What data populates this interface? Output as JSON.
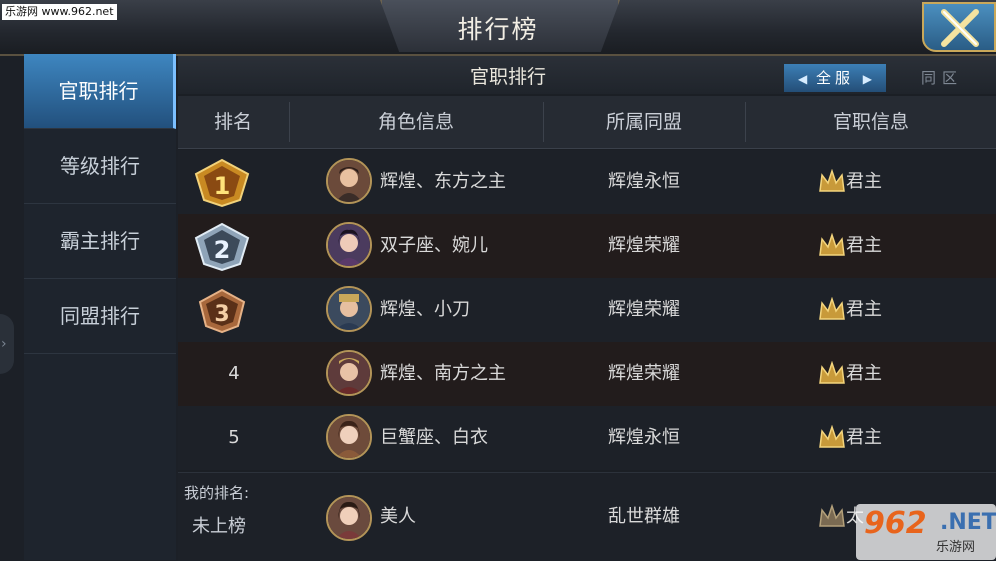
{
  "watermark_top": "乐游网 www.962.net",
  "title": "排行榜",
  "sidebar": {
    "items": [
      {
        "label": "官职排行",
        "active": true
      },
      {
        "label": "等级排行",
        "active": false
      },
      {
        "label": "霸主排行",
        "active": false
      },
      {
        "label": "同盟排行",
        "active": false
      }
    ]
  },
  "main": {
    "section_title": "官职排行",
    "tabs": {
      "server": "全服",
      "zone": "同区"
    },
    "columns": [
      "排名",
      "角色信息",
      "所属同盟",
      "官职信息"
    ],
    "rows": [
      {
        "rank": "1",
        "name": "辉煌、东方之主",
        "alliance": "辉煌永恒",
        "post": "君主"
      },
      {
        "rank": "2",
        "name": "双子座、婉儿",
        "alliance": "辉煌荣耀",
        "post": "君主"
      },
      {
        "rank": "3",
        "name": "辉煌、小刀",
        "alliance": "辉煌荣耀",
        "post": "君主"
      },
      {
        "rank": "4",
        "name": "辉煌、南方之主",
        "alliance": "辉煌荣耀",
        "post": "君主"
      },
      {
        "rank": "5",
        "name": "巨蟹座、白衣",
        "alliance": "辉煌永恒",
        "post": "君主"
      }
    ],
    "my_rank": {
      "label": "我的排名:",
      "value": "未上榜",
      "name": "美人",
      "alliance": "乱世群雄",
      "post": "太"
    }
  },
  "watermark_logo": {
    "num": "962",
    "net": ".NET",
    "sub": "乐游网"
  },
  "colors": {
    "accent_blue": "#3e86c0",
    "gold": "#c9a85a"
  }
}
